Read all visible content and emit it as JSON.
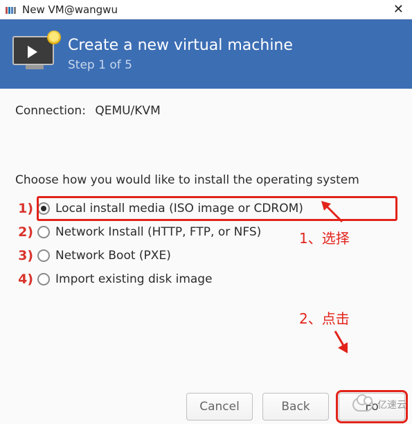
{
  "titlebar": {
    "title": "New VM@wangwu"
  },
  "header": {
    "title": "Create a new virtual machine",
    "subtitle": "Step 1 of 5"
  },
  "connection": {
    "label": "Connection:",
    "value": "QEMU/KVM"
  },
  "prompt": "Choose how you would like to install the operating system",
  "options": [
    {
      "num": "1)",
      "label": "Local install media (ISO image or CDROM)",
      "checked": true,
      "highlight": true
    },
    {
      "num": "2)",
      "label": "Network Install (HTTP, FTP, or NFS)",
      "checked": false,
      "highlight": false
    },
    {
      "num": "3)",
      "label": "Network Boot (PXE)",
      "checked": false,
      "highlight": false
    },
    {
      "num": "4)",
      "label": "Import existing disk image",
      "checked": false,
      "highlight": false
    }
  ],
  "annotations": {
    "select": "1、选择",
    "click": "2、点击"
  },
  "buttons": {
    "cancel": "Cancel",
    "back": "Back",
    "forward": "Fo"
  },
  "watermark": "亿速云"
}
